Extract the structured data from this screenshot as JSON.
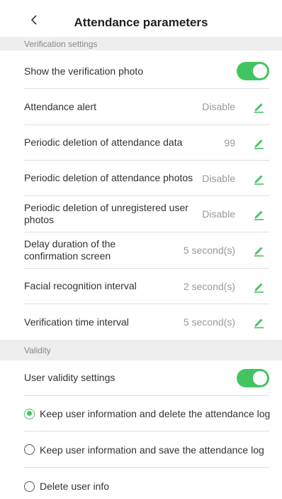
{
  "header": {
    "title": "Attendance parameters"
  },
  "colors": {
    "accent": "#43c463",
    "section_bg": "#eeeeee",
    "value_text": "#999999"
  },
  "sections": {
    "verification": "Verification settings",
    "validity": "Validity"
  },
  "verification": {
    "show_photo": {
      "label": "Show the verification photo",
      "enabled": true
    },
    "rows": [
      {
        "label": "Attendance alert",
        "value": "Disable",
        "icon": "edit-icon"
      },
      {
        "label": "Periodic deletion of attendance data",
        "value": "99",
        "icon": "edit-icon"
      },
      {
        "label": "Periodic deletion of attendance photos",
        "value": "Disable",
        "icon": "edit-icon"
      },
      {
        "label": "Periodic deletion of unregistered user photos",
        "value": "Disable",
        "icon": "edit-icon"
      },
      {
        "label": "Delay duration of the confirmation screen",
        "value": "5 second(s)",
        "icon": "edit-icon"
      },
      {
        "label": "Facial recognition interval",
        "value": "2 second(s)",
        "icon": "edit-icon"
      },
      {
        "label": "Verification time interval",
        "value": "5 second(s)",
        "icon": "edit-icon"
      }
    ]
  },
  "validity": {
    "user_validity": {
      "label": "User validity settings",
      "enabled": true
    },
    "options": [
      {
        "label": "Keep user information and delete the attendance log",
        "selected": true
      },
      {
        "label": "Keep user information and save the attendance log",
        "selected": false
      },
      {
        "label": "Delete user info",
        "selected": false
      }
    ]
  }
}
